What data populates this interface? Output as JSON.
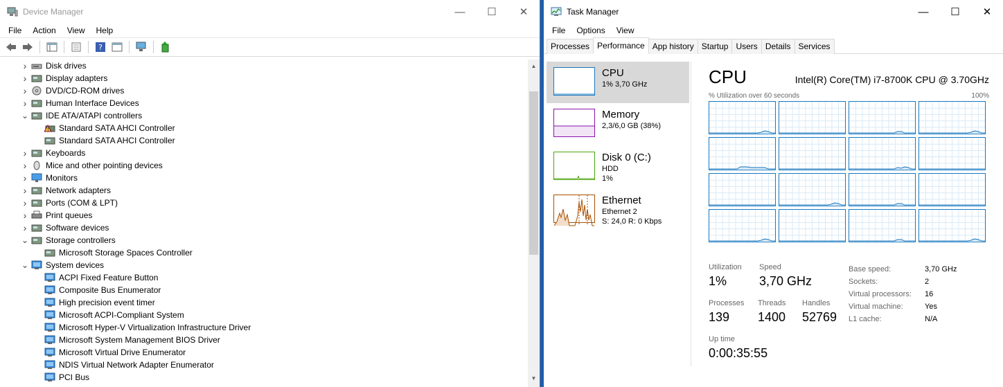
{
  "device_manager": {
    "title": "Device Manager",
    "menu": [
      "File",
      "Action",
      "View",
      "Help"
    ],
    "tree": [
      {
        "label": "Disk drives",
        "expanded": false,
        "child": false,
        "icon": "disk-drive-icon"
      },
      {
        "label": "Display adapters",
        "expanded": false,
        "child": false,
        "icon": "display-adapter-icon"
      },
      {
        "label": "DVD/CD-ROM drives",
        "expanded": false,
        "child": false,
        "icon": "dvd-drive-icon"
      },
      {
        "label": "Human Interface Devices",
        "expanded": false,
        "child": false,
        "icon": "hid-icon"
      },
      {
        "label": "IDE ATA/ATAPI controllers",
        "expanded": true,
        "child": false,
        "icon": "ide-controller-icon"
      },
      {
        "label": "Standard SATA AHCI Controller",
        "expanded": false,
        "child": true,
        "icon": "warning-controller-icon"
      },
      {
        "label": "Standard SATA AHCI Controller",
        "expanded": false,
        "child": true,
        "icon": "sata-controller-icon"
      },
      {
        "label": "Keyboards",
        "expanded": false,
        "child": false,
        "icon": "keyboard-icon"
      },
      {
        "label": "Mice and other pointing devices",
        "expanded": false,
        "child": false,
        "icon": "mouse-icon"
      },
      {
        "label": "Monitors",
        "expanded": false,
        "child": false,
        "icon": "monitor-icon"
      },
      {
        "label": "Network adapters",
        "expanded": false,
        "child": false,
        "icon": "network-adapter-icon"
      },
      {
        "label": "Ports (COM & LPT)",
        "expanded": false,
        "child": false,
        "icon": "port-icon"
      },
      {
        "label": "Print queues",
        "expanded": false,
        "child": false,
        "icon": "printer-icon"
      },
      {
        "label": "Software devices",
        "expanded": false,
        "child": false,
        "icon": "software-device-icon"
      },
      {
        "label": "Storage controllers",
        "expanded": true,
        "child": false,
        "icon": "storage-controller-icon"
      },
      {
        "label": "Microsoft Storage Spaces Controller",
        "expanded": false,
        "child": true,
        "icon": "storage-controller-icon"
      },
      {
        "label": "System devices",
        "expanded": true,
        "child": false,
        "icon": "system-device-icon"
      },
      {
        "label": "ACPI Fixed Feature Button",
        "expanded": false,
        "child": true,
        "icon": "system-device-icon"
      },
      {
        "label": "Composite Bus Enumerator",
        "expanded": false,
        "child": true,
        "icon": "system-device-icon"
      },
      {
        "label": "High precision event timer",
        "expanded": false,
        "child": true,
        "icon": "system-device-icon"
      },
      {
        "label": "Microsoft ACPI-Compliant System",
        "expanded": false,
        "child": true,
        "icon": "system-device-icon"
      },
      {
        "label": "Microsoft Hyper-V Virtualization Infrastructure Driver",
        "expanded": false,
        "child": true,
        "icon": "system-device-icon"
      },
      {
        "label": "Microsoft System Management BIOS Driver",
        "expanded": false,
        "child": true,
        "icon": "system-device-icon"
      },
      {
        "label": "Microsoft Virtual Drive Enumerator",
        "expanded": false,
        "child": true,
        "icon": "system-device-icon"
      },
      {
        "label": "NDIS Virtual Network Adapter Enumerator",
        "expanded": false,
        "child": true,
        "icon": "system-device-icon"
      },
      {
        "label": "PCI Bus",
        "expanded": false,
        "child": true,
        "icon": "system-device-icon"
      }
    ]
  },
  "task_manager": {
    "title": "Task Manager",
    "menu": [
      "File",
      "Options",
      "View"
    ],
    "tabs": [
      "Processes",
      "Performance",
      "App history",
      "Startup",
      "Users",
      "Details",
      "Services"
    ],
    "active_tab": "Performance",
    "side": [
      {
        "name": "CPU",
        "sub1": "1% 3,70 GHz",
        "sub2": "",
        "sub3": "",
        "color": "#1777bf",
        "selected": true
      },
      {
        "name": "Memory",
        "sub1": "2,3/6,0 GB (38%)",
        "sub2": "",
        "sub3": "",
        "color": "#8b12ae",
        "selected": false
      },
      {
        "name": "Disk 0 (C:)",
        "sub1": "HDD",
        "sub2": "1%",
        "sub3": "",
        "color": "#4da60c",
        "selected": false
      },
      {
        "name": "Ethernet",
        "sub1": "Ethernet 2",
        "sub2": "S: 24,0 R: 0 Kbps",
        "sub3": "",
        "color": "#a74f01",
        "selected": false
      }
    ],
    "cpu": {
      "heading": "CPU",
      "model": "Intel(R) Core(TM) i7-8700K CPU @ 3.70GHz",
      "util_caption": "% Utilization over 60 seconds",
      "util_max": "100%",
      "stats": {
        "utilization_label": "Utilization",
        "utilization": "1%",
        "speed_label": "Speed",
        "speed": "3,70 GHz",
        "processes_label": "Processes",
        "processes": "139",
        "threads_label": "Threads",
        "threads": "1400",
        "handles_label": "Handles",
        "handles": "52769",
        "uptime_label": "Up time",
        "uptime": "0:00:35:55"
      },
      "details": [
        {
          "k": "Base speed:",
          "v": "3,70 GHz"
        },
        {
          "k": "Sockets:",
          "v": "2"
        },
        {
          "k": "Virtual processors:",
          "v": "16"
        },
        {
          "k": "Virtual machine:",
          "v": "Yes"
        },
        {
          "k": "L1 cache:",
          "v": "N/A"
        }
      ]
    }
  }
}
